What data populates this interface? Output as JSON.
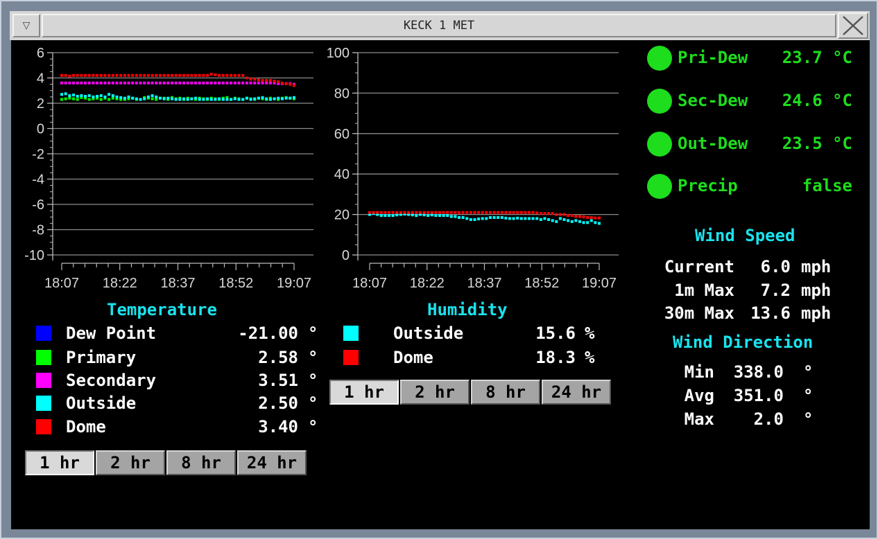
{
  "window": {
    "title": "KECK 1 MET"
  },
  "temperature": {
    "header": "Temperature",
    "ylim": [
      -10,
      6
    ],
    "yticks": [
      "6",
      "4",
      "2",
      "0",
      "-2",
      "-4",
      "-6",
      "-8",
      "-10"
    ],
    "xticks": [
      "18:07",
      "18:22",
      "18:37",
      "18:52",
      "19:07"
    ],
    "legend": [
      {
        "label": "Dew Point",
        "value": "-21.00",
        "unit": "°",
        "color": "#0000ff"
      },
      {
        "label": "Primary",
        "value": "2.58",
        "unit": "°",
        "color": "#00ff00"
      },
      {
        "label": "Secondary",
        "value": "3.51",
        "unit": "°",
        "color": "#ff00ff"
      },
      {
        "label": "Outside",
        "value": "2.50",
        "unit": "°",
        "color": "#00ffff"
      },
      {
        "label": "Dome",
        "value": "3.40",
        "unit": "°",
        "color": "#ff0000"
      }
    ],
    "buttons": [
      "1 hr",
      "2 hr",
      "8 hr",
      "24 hr"
    ],
    "selected": 0
  },
  "humidity": {
    "header": "Humidity",
    "ylim": [
      0,
      100
    ],
    "yticks": [
      "100",
      "80",
      "60",
      "40",
      "20",
      "0"
    ],
    "xticks": [
      "18:07",
      "18:22",
      "18:37",
      "18:52",
      "19:07"
    ],
    "legend": [
      {
        "label": "Outside",
        "value": "15.6",
        "unit": "%",
        "color": "#00ffff"
      },
      {
        "label": "Dome",
        "value": "18.3",
        "unit": "%",
        "color": "#ff0000"
      }
    ],
    "buttons": [
      "1 hr",
      "2 hr",
      "8 hr",
      "24 hr"
    ],
    "selected": 0
  },
  "status": [
    {
      "label": "Pri-Dew",
      "value": "23.7 °C"
    },
    {
      "label": "Sec-Dew",
      "value": "24.6 °C"
    },
    {
      "label": "Out-Dew",
      "value": "23.5 °C"
    },
    {
      "label": "Precip",
      "value": "false"
    }
  ],
  "wind_speed": {
    "header": "Wind Speed",
    "rows": [
      {
        "label": "Current",
        "value": "6.0",
        "unit": "mph"
      },
      {
        "label": "1m Max",
        "value": "7.2",
        "unit": "mph"
      },
      {
        "label": "30m Max",
        "value": "13.6",
        "unit": "mph"
      }
    ]
  },
  "wind_direction": {
    "header": "Wind Direction",
    "rows": [
      {
        "label": "Min",
        "value": "338.0",
        "unit": "°"
      },
      {
        "label": "Avg",
        "value": "351.0",
        "unit": "°"
      },
      {
        "label": "Max",
        "value": "2.0",
        "unit": "°"
      }
    ]
  },
  "chart_data": [
    {
      "type": "scatter",
      "title": "Temperature",
      "x_range": [
        "18:07",
        "19:07"
      ],
      "ylim": [
        -10,
        6
      ],
      "grid": true,
      "series": [
        {
          "name": "Primary",
          "color": "#00ff00",
          "values": [
            2.3,
            2.35,
            2.4,
            2.35,
            2.3,
            2.45,
            2.4,
            2.3,
            2.35,
            2.4,
            2.3,
            2.4,
            2.3,
            2.4,
            2.35,
            2.3,
            2.3,
            2.35,
            2.4,
            2.3,
            2.3,
            2.45,
            2.4,
            2.35,
            2.3,
            2.4,
            2.4,
            2.3,
            2.45,
            2.35,
            2.4,
            2.3,
            2.4,
            2.35,
            2.3,
            2.4,
            2.35,
            2.3,
            2.4,
            2.35,
            2.3,
            2.4,
            2.45,
            2.3,
            2.4,
            2.35,
            2.3,
            2.4,
            2.35,
            2.3,
            2.4,
            2.35,
            2.3,
            2.4,
            2.35,
            2.3,
            2.4,
            2.45,
            2.4,
            2.35
          ]
        },
        {
          "name": "Secondary",
          "color": "#ff00ff",
          "values": [
            3.6,
            3.6,
            3.6,
            3.6,
            3.6,
            3.6,
            3.6,
            3.6,
            3.6,
            3.6,
            3.6,
            3.6,
            3.6,
            3.6,
            3.6,
            3.6,
            3.6,
            3.6,
            3.6,
            3.6,
            3.6,
            3.6,
            3.6,
            3.6,
            3.6,
            3.6,
            3.6,
            3.6,
            3.6,
            3.6,
            3.6,
            3.6,
            3.6,
            3.6,
            3.6,
            3.6,
            3.6,
            3.6,
            3.6,
            3.6,
            3.6,
            3.6,
            3.6,
            3.6,
            3.6,
            3.6,
            3.6,
            3.6,
            3.6,
            3.6,
            3.6,
            3.6,
            3.6,
            3.6,
            3.6,
            3.55,
            3.55,
            3.55,
            3.55,
            3.5
          ]
        },
        {
          "name": "Outside",
          "color": "#00ffff",
          "values": [
            2.7,
            2.75,
            2.6,
            2.65,
            2.55,
            2.6,
            2.55,
            2.6,
            2.5,
            2.55,
            2.6,
            2.5,
            2.7,
            2.6,
            2.5,
            2.45,
            2.4,
            2.5,
            2.4,
            2.35,
            2.3,
            2.35,
            2.5,
            2.6,
            2.5,
            2.4,
            2.35,
            2.4,
            2.35,
            2.3,
            2.3,
            2.35,
            2.3,
            2.35,
            2.4,
            2.3,
            2.3,
            2.35,
            2.3,
            2.3,
            2.35,
            2.3,
            2.3,
            2.3,
            2.35,
            2.3,
            2.3,
            2.4,
            2.3,
            2.35,
            2.4,
            2.45,
            2.35,
            2.3,
            2.35,
            2.4,
            2.35,
            2.4,
            2.4,
            2.45
          ]
        },
        {
          "name": "Dome",
          "color": "#ff0000",
          "values": [
            4.2,
            4.2,
            4.15,
            4.2,
            4.2,
            4.2,
            4.2,
            4.2,
            4.2,
            4.2,
            4.2,
            4.2,
            4.2,
            4.2,
            4.2,
            4.2,
            4.2,
            4.2,
            4.2,
            4.2,
            4.2,
            4.2,
            4.2,
            4.2,
            4.2,
            4.2,
            4.2,
            4.2,
            4.2,
            4.2,
            4.2,
            4.2,
            4.2,
            4.2,
            4.2,
            4.2,
            4.2,
            4.2,
            4.3,
            4.25,
            4.2,
            4.2,
            4.2,
            4.2,
            4.2,
            4.2,
            4.2,
            4.0,
            3.9,
            3.9,
            3.85,
            3.8,
            3.8,
            3.8,
            3.75,
            3.7,
            3.6,
            3.55,
            3.5,
            3.4
          ]
        }
      ]
    },
    {
      "type": "scatter",
      "title": "Humidity",
      "x_range": [
        "18:07",
        "19:07"
      ],
      "ylim": [
        0,
        100
      ],
      "grid": true,
      "series": [
        {
          "name": "Outside",
          "color": "#00ffff",
          "values": [
            20.0,
            20.5,
            20.0,
            19.5,
            19.5,
            19.5,
            19.5,
            19.8,
            20.0,
            20.2,
            20.0,
            19.8,
            19.5,
            20.0,
            19.8,
            19.5,
            19.8,
            19.5,
            19.5,
            19.5,
            19.5,
            19.0,
            19.0,
            18.5,
            18.5,
            18.0,
            17.5,
            17.5,
            17.8,
            18.0,
            18.0,
            18.5,
            18.5,
            18.5,
            18.5,
            18.2,
            18.0,
            18.0,
            18.2,
            18.0,
            18.0,
            18.0,
            18.0,
            18.0,
            17.5,
            18.0,
            17.5,
            17.0,
            16.5,
            18.0,
            17.5,
            17.0,
            16.5,
            17.0,
            16.5,
            16.0,
            16.0,
            17.0,
            16.0,
            15.6
          ]
        },
        {
          "name": "Dome",
          "color": "#ff0000",
          "values": [
            21.0,
            21.0,
            21.0,
            21.0,
            21.0,
            21.0,
            21.0,
            21.0,
            21.0,
            21.0,
            21.0,
            21.0,
            21.0,
            21.0,
            21.0,
            21.0,
            21.0,
            21.0,
            21.0,
            21.0,
            21.0,
            21.0,
            21.0,
            21.0,
            21.0,
            21.0,
            21.0,
            21.0,
            21.0,
            21.0,
            21.0,
            21.0,
            21.0,
            21.0,
            21.0,
            21.0,
            21.0,
            21.0,
            21.0,
            21.0,
            21.0,
            21.0,
            21.0,
            20.8,
            20.5,
            20.5,
            20.5,
            20.5,
            20.0,
            20.0,
            20.0,
            19.5,
            19.5,
            19.0,
            19.0,
            18.8,
            18.5,
            18.5,
            18.3,
            18.3
          ]
        }
      ]
    }
  ]
}
